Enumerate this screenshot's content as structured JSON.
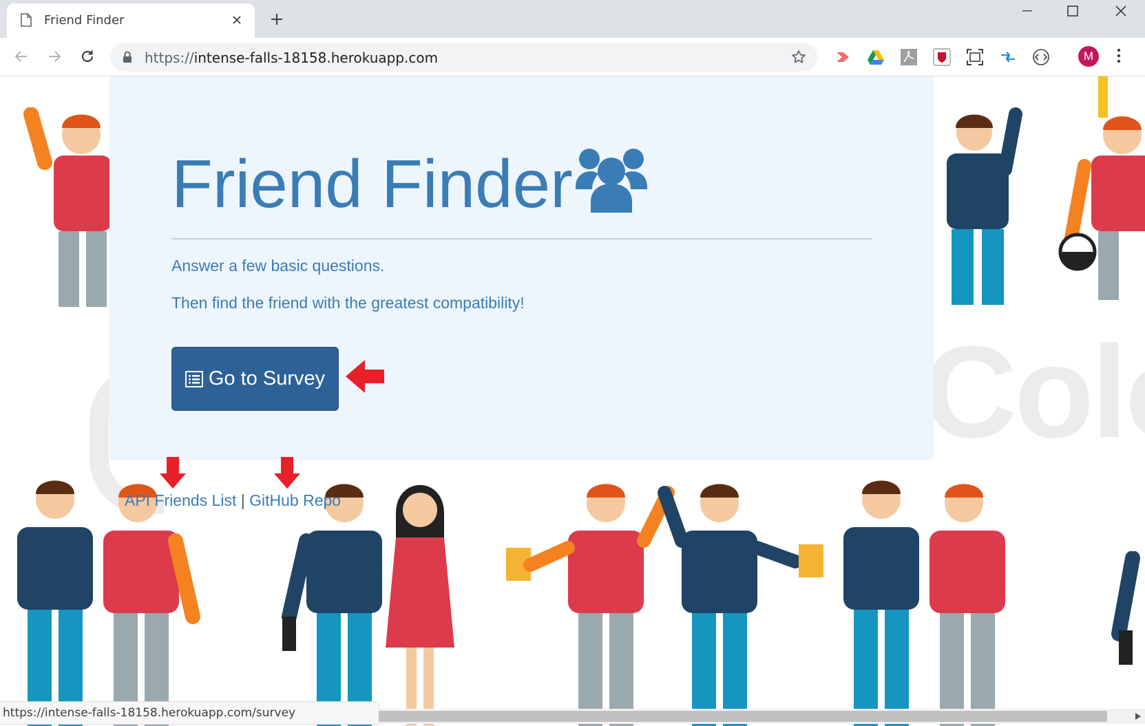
{
  "browser": {
    "tab_title": "Friend Finder",
    "url_scheme": "https://",
    "url_host": "intense-falls-18158.herokuapp.com",
    "profile_initial": "M",
    "extensions": [
      "video-extension-icon",
      "google-drive-icon",
      "pdf-icon",
      "mcafee-icon",
      "screenshot-icon",
      "sync-arrows-icon",
      "code-brackets-icon"
    ]
  },
  "page": {
    "title": "Friend Finder",
    "title_icon": "users-icon",
    "lead_1": "Answer a few basic questions.",
    "lead_2": "Then find the friend with the greatest compatibility!",
    "survey_button": "Go to Survey",
    "survey_button_icon": "list-icon",
    "link_api": "API Friends List",
    "link_separator": "|",
    "link_github": "GitHub Repo",
    "background_word": "Colo"
  },
  "status_url": "https://intense-falls-18158.herokuapp.com/survey",
  "colors": {
    "accent": "#3a7cb5",
    "button": "#2e6195",
    "jumbotron": "#eef6fd",
    "annotation_arrow": "#e8202a"
  }
}
